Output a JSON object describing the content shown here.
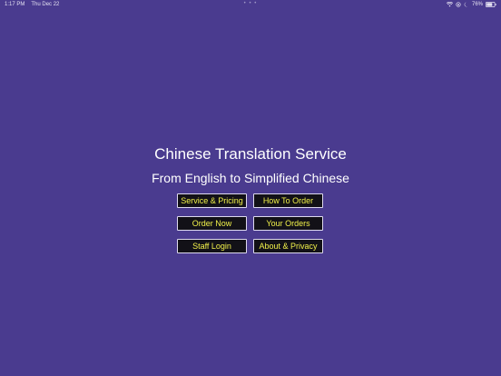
{
  "status_bar": {
    "time": "1:17 PM",
    "date": "Thu Dec 22",
    "dots": "• • •",
    "battery_percent": "76%",
    "battery_level": 0.76,
    "icons": [
      "wifi-icon",
      "orientation-lock-icon",
      "moon-icon",
      "battery-icon"
    ]
  },
  "main": {
    "title": "Chinese Translation Service",
    "subtitle": "From English to Simplified Chinese"
  },
  "buttons": {
    "service_pricing": "Service & Pricing",
    "how_to_order": "How To Order",
    "order_now": "Order Now",
    "your_orders": "Your Orders",
    "staff_login": "Staff Login",
    "about_privacy": "About & Privacy"
  },
  "colors": {
    "background": "#4a3b8f",
    "button_background": "#121117",
    "button_text": "#f2f24a",
    "text": "#ffffff"
  }
}
